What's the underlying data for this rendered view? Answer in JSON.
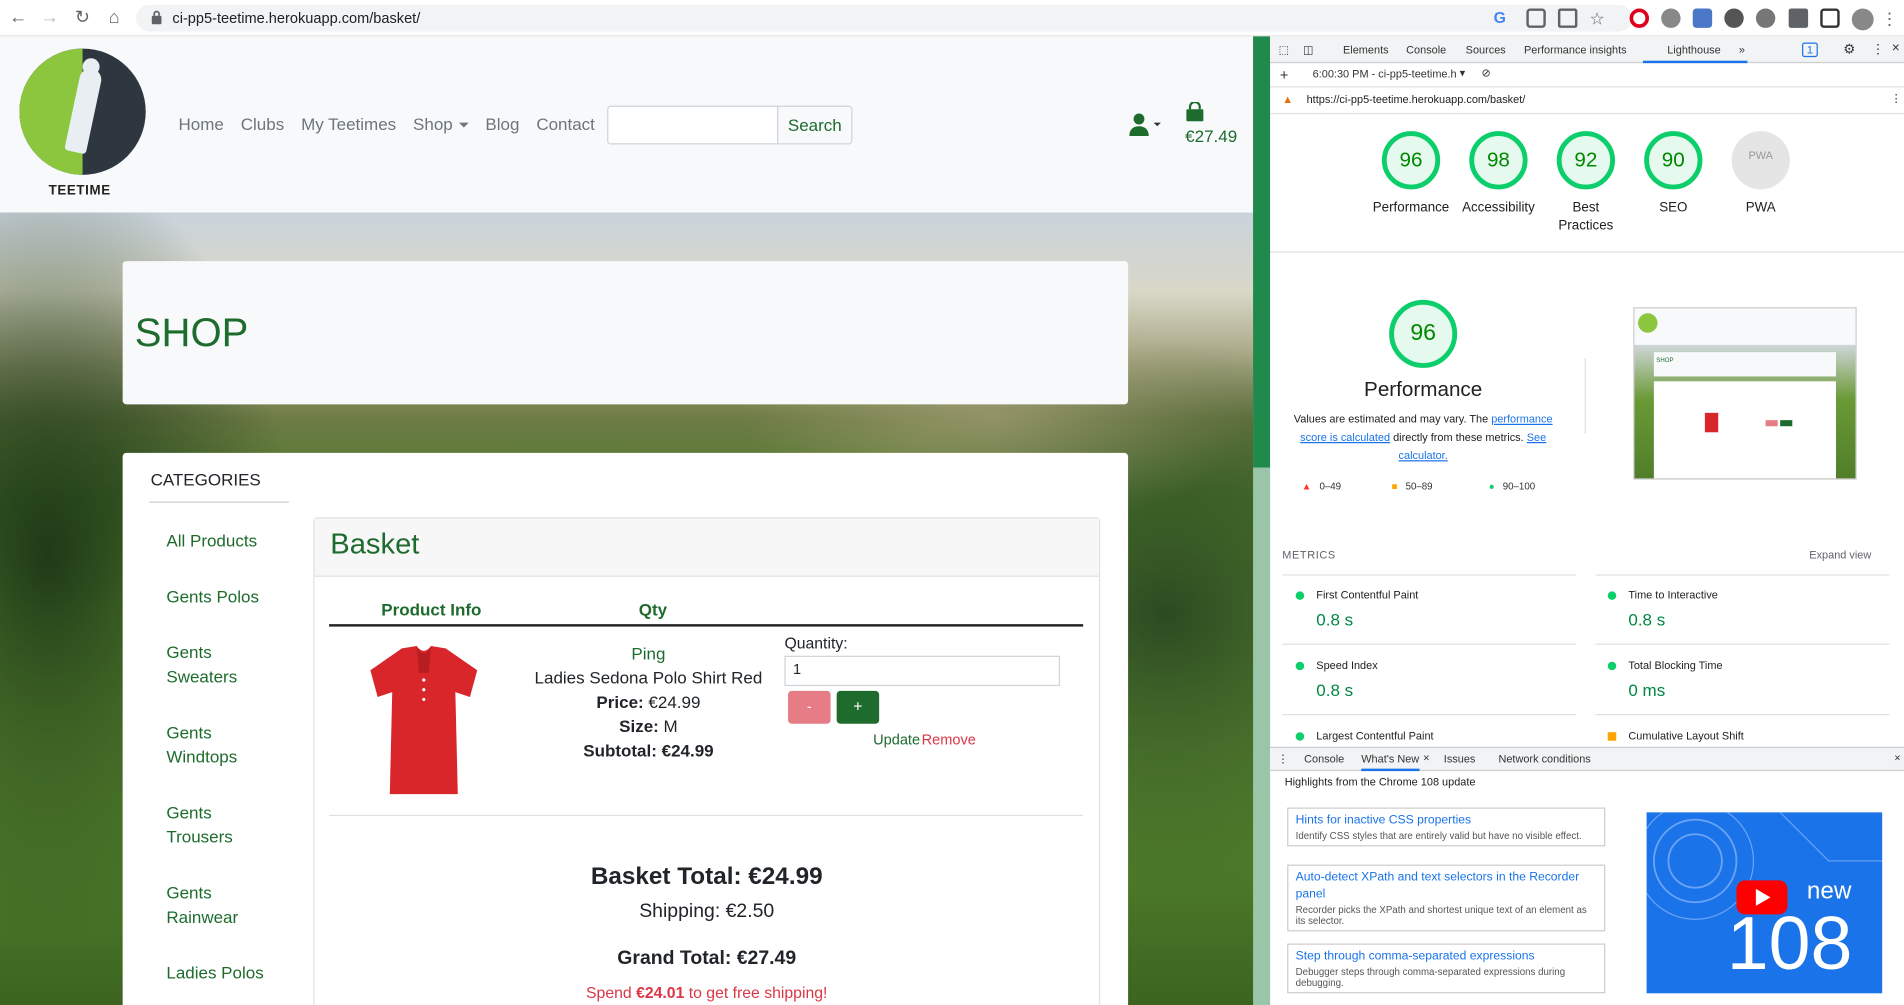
{
  "browser": {
    "url": "ci-pp5-teetime.herokuapp.com/basket/"
  },
  "site": {
    "logo_text": "TEETIME",
    "nav": [
      "Home",
      "Clubs",
      "My Teetimes",
      "Shop",
      "Blog",
      "Contact"
    ],
    "search_button": "Search",
    "search_placeholder": "",
    "bag_total": "€27.49"
  },
  "shop": {
    "title": "SHOP"
  },
  "categories": {
    "title": "CATEGORIES",
    "items": [
      "All Products",
      "Gents Polos",
      "Gents Sweaters",
      "Gents Windtops",
      "Gents Trousers",
      "Gents Rainwear",
      "Ladies Polos"
    ]
  },
  "basket": {
    "title": "Basket",
    "col_product": "Product Info",
    "col_qty": "Qty",
    "item": {
      "brand": "Ping",
      "name": "Ladies Sedona Polo Shirt Red",
      "price_label": "Price:",
      "price": "€24.99",
      "size_label": "Size:",
      "size": "M",
      "subtotal": "Subtotal: €24.99"
    },
    "qty_label": "Quantity:",
    "qty_value": "1",
    "minus": "-",
    "plus": "+",
    "update": "Update",
    "remove": "Remove",
    "basket_total": "Basket Total: €24.99",
    "shipping": "Shipping: €2.50",
    "grand_total": "Grand Total: €27.49",
    "spend_pre": "Spend ",
    "spend_amount": "€24.01",
    "spend_post": " to get free shipping!"
  },
  "devtools": {
    "tabs": [
      "Elements",
      "Console",
      "Sources",
      "Performance insights",
      "Lighthouse"
    ],
    "issues_count": "1",
    "report_time": "6:00:30 PM - ci-pp5-teetime.h",
    "report_url": "https://ci-pp5-teetime.herokuapp.com/basket/",
    "scores": [
      {
        "label": "Performance",
        "value": "96"
      },
      {
        "label": "Accessibility",
        "value": "98"
      },
      {
        "label": "Best Practices",
        "value": "92"
      },
      {
        "label": "SEO",
        "value": "90"
      }
    ],
    "pwa_label": "PWA",
    "pwa_badge": "PWA",
    "perf_score": "96",
    "perf_title": "Performance",
    "perf_desc_1": "Values are estimated and may vary. The ",
    "perf_desc_link1": "performance score is calculated",
    "perf_desc_2": " directly from these metrics. ",
    "perf_desc_link2": "See calculator.",
    "legend": [
      "0–49",
      "50–89",
      "90–100"
    ],
    "metrics_title": "METRICS",
    "expand_view": "Expand view",
    "metrics": [
      {
        "label": "First Contentful Paint",
        "value": "0.8 s"
      },
      {
        "label": "Time to Interactive",
        "value": "0.8 s"
      },
      {
        "label": "Speed Index",
        "value": "0.8 s"
      },
      {
        "label": "Total Blocking Time",
        "value": "0 ms"
      },
      {
        "label": "Largest Contentful Paint",
        "value": ""
      },
      {
        "label": "Cumulative Layout Shift",
        "value": ""
      }
    ],
    "drawer_tabs": [
      "Console",
      "What's New",
      "Issues",
      "Network conditions"
    ],
    "drawer_subtitle": "Highlights from the Chrome 108 update",
    "whats_new": [
      {
        "title": "Hints for inactive CSS properties",
        "desc": "Identify CSS styles that are entirely valid but have no visible effect."
      },
      {
        "title": "Auto-detect XPath and text selectors in the Recorder panel",
        "desc": "Recorder picks the XPath and shortest unique text of an element as its selector."
      },
      {
        "title": "Step through comma-separated expressions",
        "desc": "Debugger steps through comma-separated expressions during debugging."
      }
    ],
    "video_new": "new",
    "video_num": "108"
  },
  "colors": {
    "brand_green": "#1e6b2e",
    "score_green": "#0cce6b",
    "red": "#dc3545"
  }
}
